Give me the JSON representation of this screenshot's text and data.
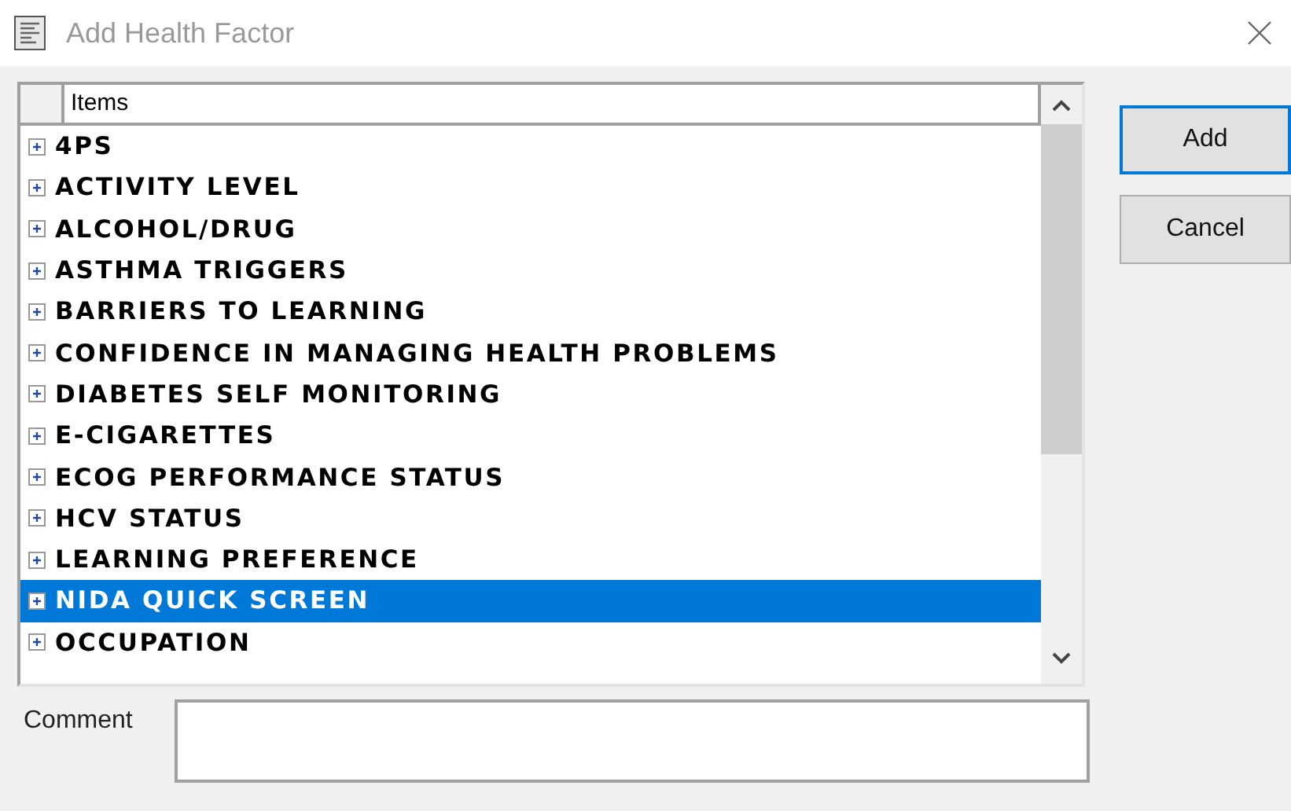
{
  "window": {
    "title": "Add Health Factor"
  },
  "list": {
    "column": "Items",
    "items": [
      {
        "label": "4PS",
        "selected": false
      },
      {
        "label": "ACTIVITY LEVEL",
        "selected": false
      },
      {
        "label": "ALCOHOL/DRUG",
        "selected": false
      },
      {
        "label": "ASTHMA TRIGGERS",
        "selected": false
      },
      {
        "label": "BARRIERS TO LEARNING",
        "selected": false
      },
      {
        "label": "CONFIDENCE IN MANAGING HEALTH PROBLEMS",
        "selected": false
      },
      {
        "label": "DIABETES SELF MONITORING",
        "selected": false
      },
      {
        "label": "E-CIGARETTES",
        "selected": false
      },
      {
        "label": "ECOG PERFORMANCE STATUS",
        "selected": false
      },
      {
        "label": "HCV STATUS",
        "selected": false
      },
      {
        "label": "LEARNING PREFERENCE",
        "selected": false
      },
      {
        "label": "NIDA QUICK SCREEN",
        "selected": true
      },
      {
        "label": "OCCUPATION",
        "selected": false
      }
    ]
  },
  "buttons": [
    {
      "label": "Add",
      "default": true
    },
    {
      "label": "Cancel",
      "default": false
    }
  ],
  "comment": {
    "label": "Comment"
  }
}
